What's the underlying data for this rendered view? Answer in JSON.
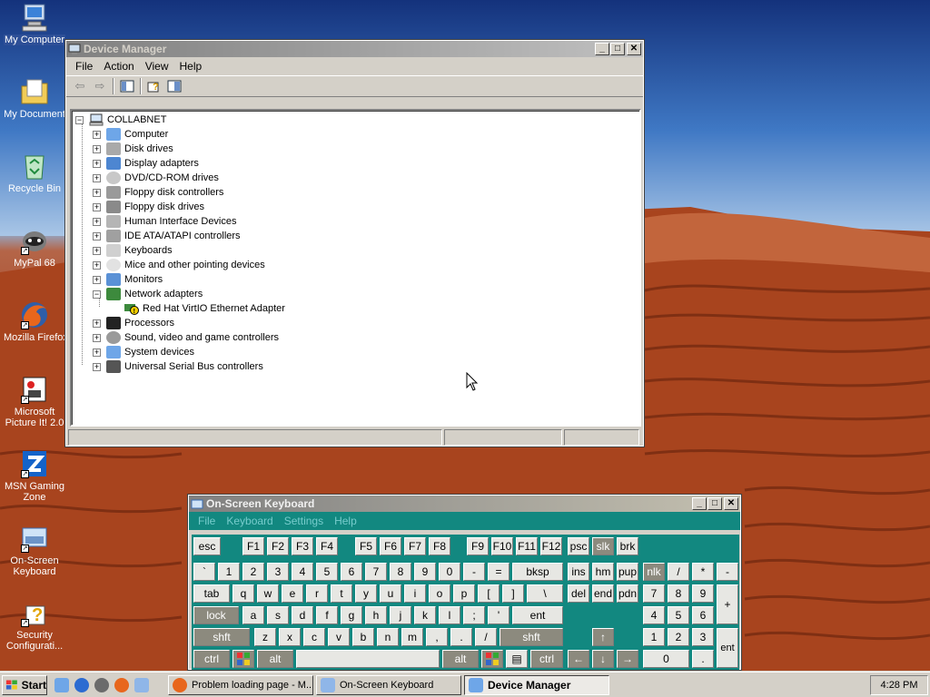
{
  "desktop": {
    "icons": [
      {
        "label": "My Computer",
        "icon": "my-computer-icon"
      },
      {
        "label": "My Document",
        "icon": "my-documents-icon"
      },
      {
        "label": "Recycle Bin",
        "icon": "recycle-bin-icon"
      },
      {
        "label": "MyPal 68",
        "icon": "mypal-icon"
      },
      {
        "label": "Mozilla Firefox",
        "icon": "firefox-icon"
      },
      {
        "label": "Microsoft Picture It! 2.0",
        "icon": "picture-it-icon"
      },
      {
        "label": "MSN Gaming Zone",
        "icon": "msn-zone-icon"
      },
      {
        "label": "On-Screen Keyboard",
        "icon": "osk-icon"
      },
      {
        "label": "Security Configurati...",
        "icon": "security-config-icon"
      }
    ]
  },
  "device_manager": {
    "title": "Device Manager",
    "menu": [
      "File",
      "Action",
      "View",
      "Help"
    ],
    "root": "COLLABNET",
    "categories": [
      "Computer",
      "Disk drives",
      "Display adapters",
      "DVD/CD-ROM drives",
      "Floppy disk controllers",
      "Floppy disk drives",
      "Human Interface Devices",
      "IDE ATA/ATAPI controllers",
      "Keyboards",
      "Mice and other pointing devices",
      "Monitors",
      "Network adapters",
      "Processors",
      "Sound, video and game controllers",
      "System devices",
      "Universal Serial Bus controllers"
    ],
    "expanded_child": "Red Hat VirtIO Ethernet Adapter",
    "plus": "+",
    "minus": "−"
  },
  "osk": {
    "title": "On-Screen Keyboard",
    "menu": [
      "File",
      "Keyboard",
      "Settings",
      "Help"
    ],
    "row_fn": [
      "esc",
      "F1",
      "F2",
      "F3",
      "F4",
      "F5",
      "F6",
      "F7",
      "F8",
      "F9",
      "F10",
      "F11",
      "F12",
      "psc",
      "slk",
      "brk"
    ],
    "row_num": [
      "`",
      "1",
      "2",
      "3",
      "4",
      "5",
      "6",
      "7",
      "8",
      "9",
      "0",
      "-",
      "=",
      "bksp",
      "ins",
      "hm",
      "pup",
      "nlk",
      "/",
      "*",
      "-"
    ],
    "row_tab": [
      "tab",
      "q",
      "w",
      "e",
      "r",
      "t",
      "y",
      "u",
      "i",
      "o",
      "p",
      "[",
      "]",
      "\\",
      "del",
      "end",
      "pdn",
      "7",
      "8",
      "9",
      "+"
    ],
    "row_caps": [
      "lock",
      "a",
      "s",
      "d",
      "f",
      "g",
      "h",
      "j",
      "k",
      "l",
      ";",
      "'",
      "ent",
      "4",
      "5",
      "6"
    ],
    "row_shift": [
      "shft",
      "z",
      "x",
      "c",
      "v",
      "b",
      "n",
      "m",
      ",",
      ".",
      "/",
      "shft",
      "↑",
      "1",
      "2",
      "3",
      "ent"
    ],
    "row_ctrl": [
      "ctrl",
      "",
      "alt",
      "",
      "alt",
      "",
      "",
      "ctrl",
      "←",
      "↓",
      "→",
      "0",
      "."
    ]
  },
  "taskbar": {
    "start": "Start",
    "tasks": [
      "Problem loading page - M...",
      "On-Screen Keyboard",
      "Device Manager"
    ],
    "clock": "4:28 PM"
  }
}
